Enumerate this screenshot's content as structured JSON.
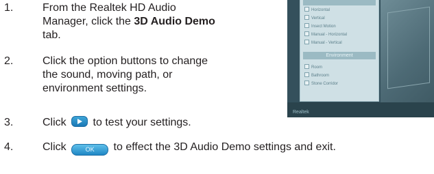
{
  "steps": [
    {
      "number": "1.",
      "line1": "From the Realtek HD Audio",
      "line2_pre": "Manager, click the ",
      "line2_bold": "3D Audio Demo",
      "line3": "tab."
    },
    {
      "number": "2.",
      "line1": "Click the option buttons to change",
      "line2": "the sound, moving path, or",
      "line3": "environment settings."
    },
    {
      "number": "3.",
      "pre": "Click ",
      "post": " to test your settings.",
      "icon": "play-button-icon"
    },
    {
      "number": "4.",
      "pre": "Click ",
      "post": " to effect the 3D Audio Demo settings and exit.",
      "icon": "ok-button-icon",
      "button_label": "OK"
    }
  ],
  "thumbnail": {
    "moving_path_options": [
      "Horizontal",
      "Vertical",
      "Insect Motion",
      "Manual - Horizontal",
      "Manual - Vertical"
    ],
    "environment_header": "Environment",
    "environment_options": [
      "Room",
      "Bathroom",
      "Stone Corridor"
    ],
    "logo": "Realtek"
  },
  "colors": {
    "text": "#231f20",
    "button_blue": "#1f86c4"
  }
}
